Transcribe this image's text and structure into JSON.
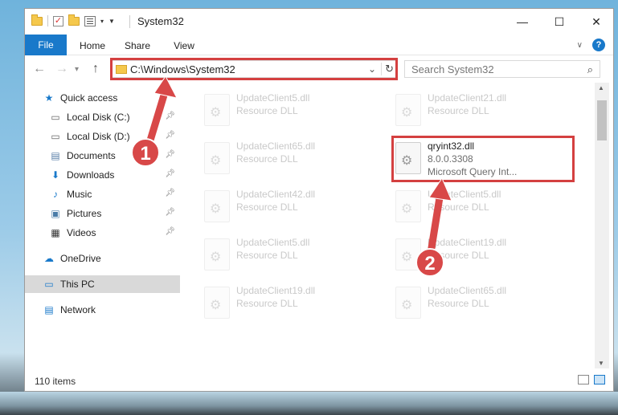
{
  "window": {
    "title": "System32",
    "minimize_icon": "minimize-icon",
    "maximize_icon": "maximize-icon",
    "close_icon": "close-icon"
  },
  "ribbon": {
    "tabs": [
      "File",
      "Home",
      "Share",
      "View"
    ],
    "help": "?"
  },
  "address_bar": {
    "path": "C:\\Windows\\System32"
  },
  "search": {
    "placeholder": "Search System32"
  },
  "sidebar": {
    "items": [
      {
        "label": "Quick access",
        "icon": "star-icon",
        "pinned": false
      },
      {
        "label": "Local Disk (C:)",
        "icon": "drive-icon",
        "pinned": true
      },
      {
        "label": "Local Disk (D:)",
        "icon": "drive-icon",
        "pinned": true
      },
      {
        "label": "Documents",
        "icon": "documents-icon",
        "pinned": true
      },
      {
        "label": "Downloads",
        "icon": "download-icon",
        "pinned": true
      },
      {
        "label": "Music",
        "icon": "music-icon",
        "pinned": true
      },
      {
        "label": "Pictures",
        "icon": "pictures-icon",
        "pinned": true
      },
      {
        "label": "Videos",
        "icon": "videos-icon",
        "pinned": true
      },
      {
        "label": "OneDrive",
        "icon": "cloud-icon",
        "pinned": false
      },
      {
        "label": "This PC",
        "icon": "pc-icon",
        "pinned": false
      },
      {
        "label": "Network",
        "icon": "network-icon",
        "pinned": false
      }
    ]
  },
  "files": [
    {
      "name": "UpdateClient5.dll",
      "desc": "Resource DLL"
    },
    {
      "name": "UpdateClient21.dll",
      "desc": "Resource DLL"
    },
    {
      "name": "UpdateClient65.dll",
      "desc": "Resource DLL"
    },
    {
      "name": "qryint32.dll",
      "desc": "8.0.0.3308",
      "desc2": "Microsoft Query Int..."
    },
    {
      "name": "UpdateClient42.dll",
      "desc": "Resource DLL"
    },
    {
      "name": "UpdateClient5.dll",
      "desc": "Resource DLL"
    },
    {
      "name": "UpdateClient5.dll",
      "desc": "Resource DLL"
    },
    {
      "name": "UpdateClient19.dll",
      "desc": "Resource DLL"
    },
    {
      "name": "UpdateClient19.dll",
      "desc": "Resource DLL"
    },
    {
      "name": "UpdateClient65.dll",
      "desc": "Resource DLL"
    }
  ],
  "status": {
    "items_count": "110 items"
  },
  "callouts": {
    "one": "1",
    "two": "2"
  },
  "colors": {
    "accent": "#1979ca",
    "highlight": "#d44040"
  }
}
